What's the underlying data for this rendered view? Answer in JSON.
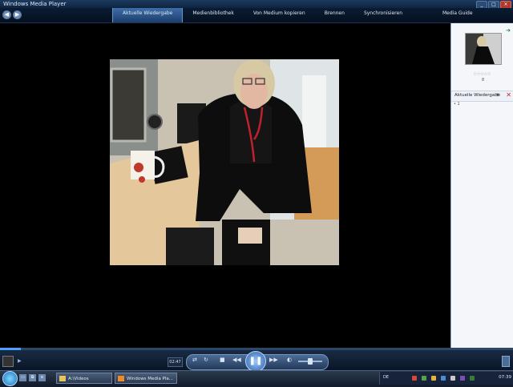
{
  "window": {
    "title": "Windows Media Player"
  },
  "nav": {
    "tabs": [
      {
        "label": "Aktuelle Wiedergabe",
        "active": true
      },
      {
        "label": "Medienbibliothek",
        "active": false
      },
      {
        "label": "Von Medium kopieren",
        "active": false
      },
      {
        "label": "Brennen",
        "active": false
      },
      {
        "label": "Synchronisieren",
        "active": false
      },
      {
        "label": "Media Guide",
        "active": false
      }
    ]
  },
  "sidepanel": {
    "rating_stars": "☆☆☆☆☆",
    "rating_count": "8",
    "now_playing_label": "Aktuelle Wiedergabe",
    "playlist_entry": "• 1"
  },
  "controls": {
    "time": "02:47",
    "seek_progress": 0.04,
    "volume_level": 0.5
  },
  "taskbar": {
    "tasks": [
      {
        "label": "A:\\Videos"
      },
      {
        "label": "Windows Media Pla..."
      }
    ],
    "language": "DE",
    "clock": "07:39"
  },
  "colors": {
    "accent": "#3e6da8",
    "play_button": "#2c5fa4",
    "seek_fill": "#4ea0ff"
  }
}
